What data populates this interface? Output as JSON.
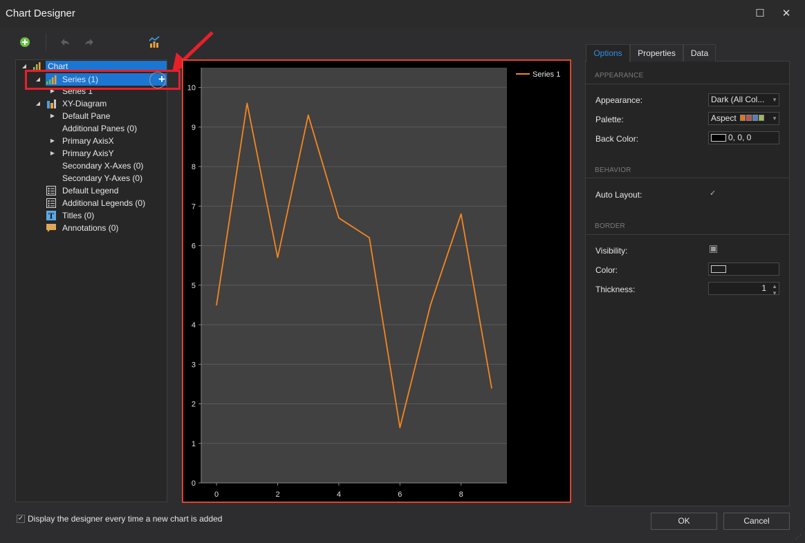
{
  "window": {
    "title": "Chart Designer",
    "maximize_glyph": "☐",
    "close_glyph": "✕"
  },
  "toolbar": {
    "add_icon": "add-icon",
    "undo_icon": "undo-icon",
    "redo_icon": "redo-icon",
    "chart_wizard_icon": "chart-wizard-icon"
  },
  "tree": {
    "items": [
      {
        "label": "Chart"
      },
      {
        "label": "Series (1)"
      },
      {
        "label": "Series 1"
      },
      {
        "label": "XY-Diagram"
      },
      {
        "label": "Default Pane"
      },
      {
        "label": "Additional Panes (0)"
      },
      {
        "label": "Primary AxisX"
      },
      {
        "label": "Primary AxisY"
      },
      {
        "label": "Secondary X-Axes (0)"
      },
      {
        "label": "Secondary Y-Axes (0)"
      },
      {
        "label": "Default Legend"
      },
      {
        "label": "Additional Legends (0)"
      },
      {
        "label": "Titles (0)"
      },
      {
        "label": "Annotations (0)"
      }
    ],
    "add_button_glyph": "+"
  },
  "chart_data": {
    "type": "line",
    "x": [
      0,
      1,
      2,
      3,
      4,
      5,
      6,
      7,
      8,
      9
    ],
    "series": [
      {
        "name": "Series 1",
        "values": [
          4.5,
          9.6,
          5.7,
          9.3,
          6.7,
          6.2,
          1.4,
          4.5,
          6.8,
          2.4
        ]
      }
    ],
    "xticks": [
      "0",
      "2",
      "4",
      "6",
      "8"
    ],
    "yticks": [
      "0",
      "1",
      "2",
      "3",
      "4",
      "5",
      "6",
      "7",
      "8",
      "9",
      "10"
    ],
    "xlim": [
      -0.5,
      9.5
    ],
    "ylim": [
      0,
      10.5
    ],
    "legend": "top-right",
    "grid": true,
    "colors": {
      "line": "#f5871f",
      "pane": "#414141",
      "background": "#000000"
    }
  },
  "tabs": [
    {
      "label": "Options",
      "active": true
    },
    {
      "label": "Properties",
      "active": false
    },
    {
      "label": "Data",
      "active": false
    }
  ],
  "options": {
    "appearance_section": "APPEARANCE",
    "appearance_label": "Appearance:",
    "appearance_value": "Dark (All Col...",
    "palette_label": "Palette:",
    "palette_value": "Aspect",
    "palette_colors": [
      "#e8731a",
      "#c0504d",
      "#4f81bd",
      "#9bbb59"
    ],
    "back_color_label": "Back Color:",
    "back_color_value": "0, 0, 0",
    "behavior_section": "BEHAVIOR",
    "auto_layout_label": "Auto Layout:",
    "auto_layout_checked": true,
    "border_section": "BORDER",
    "visibility_label": "Visibility:",
    "color_label": "Color:",
    "thickness_label": "Thickness:",
    "thickness_value": "1"
  },
  "footer": {
    "checkbox_label": "Display the designer every time a new chart is added",
    "checkbox_checked": true,
    "ok_label": "OK",
    "cancel_label": "Cancel"
  }
}
